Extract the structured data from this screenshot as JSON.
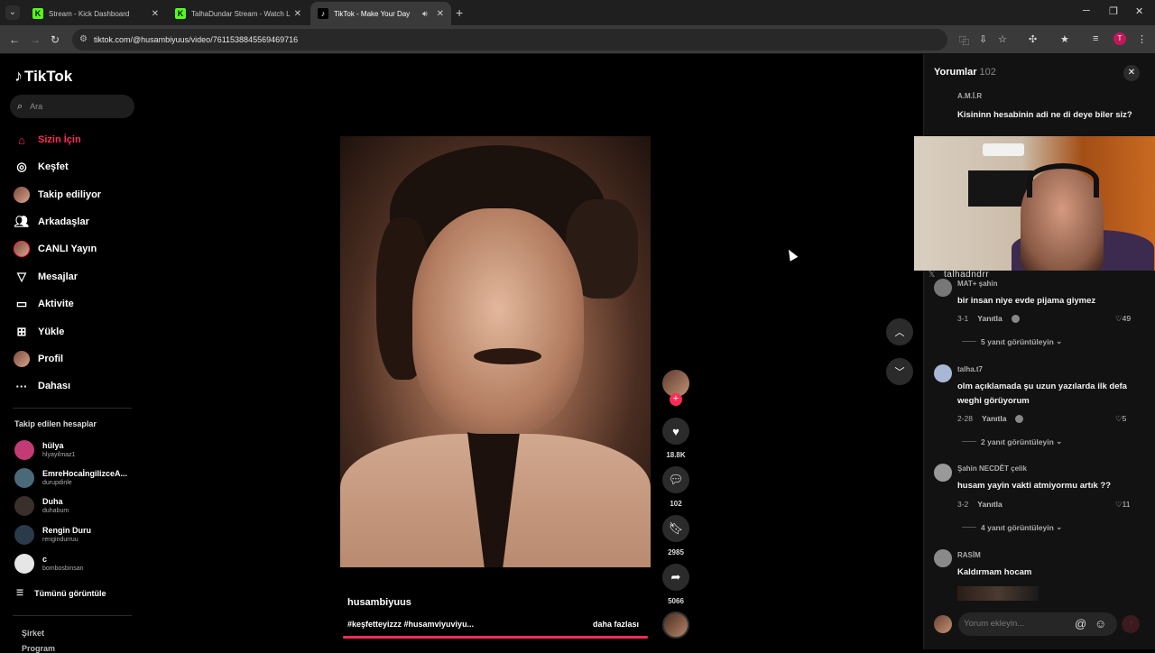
{
  "browser": {
    "tabs": [
      {
        "title": "Stream - Kick Dashboard",
        "icon": "kick-icon",
        "active": false
      },
      {
        "title": "TalhaDundar Stream - Watch Live",
        "icon": "kick-icon",
        "active": false
      },
      {
        "title": "TikTok - Make Your Day",
        "icon": "tiktok-icon",
        "active": true
      }
    ],
    "url": "tiktok.com/@husambiyuus/video/7611538845569469716",
    "profile_initial": "T"
  },
  "app": {
    "logo": "TikTok",
    "search_placeholder": "Ara",
    "nav": [
      {
        "label": "Sizin İçin",
        "icon": "home-icon",
        "active": true
      },
      {
        "label": "Keşfet",
        "icon": "compass-icon"
      },
      {
        "label": "Takip ediliyor",
        "icon": "following-avatar-icon"
      },
      {
        "label": "Arkadaşlar",
        "icon": "friends-icon"
      },
      {
        "label": "CANLI Yayın",
        "icon": "live-avatar-icon"
      },
      {
        "label": "Mesajlar",
        "icon": "send-icon"
      },
      {
        "label": "Aktivite",
        "icon": "activity-icon"
      },
      {
        "label": "Yükle",
        "icon": "upload-icon"
      },
      {
        "label": "Profil",
        "icon": "profile-avatar-icon"
      },
      {
        "label": "Dahası",
        "icon": "more-icon"
      }
    ],
    "following_title": "Takip edilen hesaplar",
    "following": [
      {
        "name": "hülya",
        "user": "hlyayilmaz1",
        "color": "#c23b74"
      },
      {
        "name": "EmreHocaİngilizceA...",
        "user": "durupdinle",
        "color": "#4a6a7a"
      },
      {
        "name": "Duha",
        "user": "duhabum",
        "color": "#3a2f2a"
      },
      {
        "name": "Rengin Duru",
        "user": "rengindurruu",
        "color": "#2a3a4a"
      },
      {
        "name": "c",
        "user": "bombosbinsan",
        "color": "#e6e6e6"
      }
    ],
    "see_all": "Tümünü görüntüle",
    "footer_company": "Şirket",
    "footer_program": "Program"
  },
  "video": {
    "author": "husambiyuus",
    "caption": "#keşfetteyizzz #husamviyuviyu...",
    "more": "daha fazlası",
    "likes": "18.8K",
    "comments": "102",
    "saves": "2985",
    "shares": "5066"
  },
  "comments": {
    "title": "Yorumlar",
    "count": "102",
    "items": [
      {
        "user": "A.M.İ.R",
        "text": "Kisininn hesabinin adi ne di deye biler siz?"
      },
      {
        "user": "MAT+ şahin",
        "text": "bir insan niye evde pijama giymez",
        "date": "3-1",
        "reply": "Yanıtla",
        "likes": "49",
        "view_replies": "5 yanıt görüntüleyin"
      },
      {
        "user": "talha.t7",
        "text": "olm açıklamada şu uzun yazılarda ilk defa weghi görüyorum",
        "date": "2-28",
        "reply": "Yanıtla",
        "likes": "5",
        "view_replies": "2 yanıt görüntüleyin"
      },
      {
        "user": "Şahin NECDÊT çelik",
        "text": "husam yayin vakti atmiyormu artık ??",
        "date": "3-2",
        "reply": "Yanıtla",
        "likes": "11",
        "view_replies": "4 yanıt görüntüleyin"
      },
      {
        "user": "RASİM",
        "text": "Kaldırmam hocam"
      }
    ],
    "input_placeholder": "Yorum ekleyin..."
  },
  "webcam": {
    "name": "talhadndrr"
  }
}
